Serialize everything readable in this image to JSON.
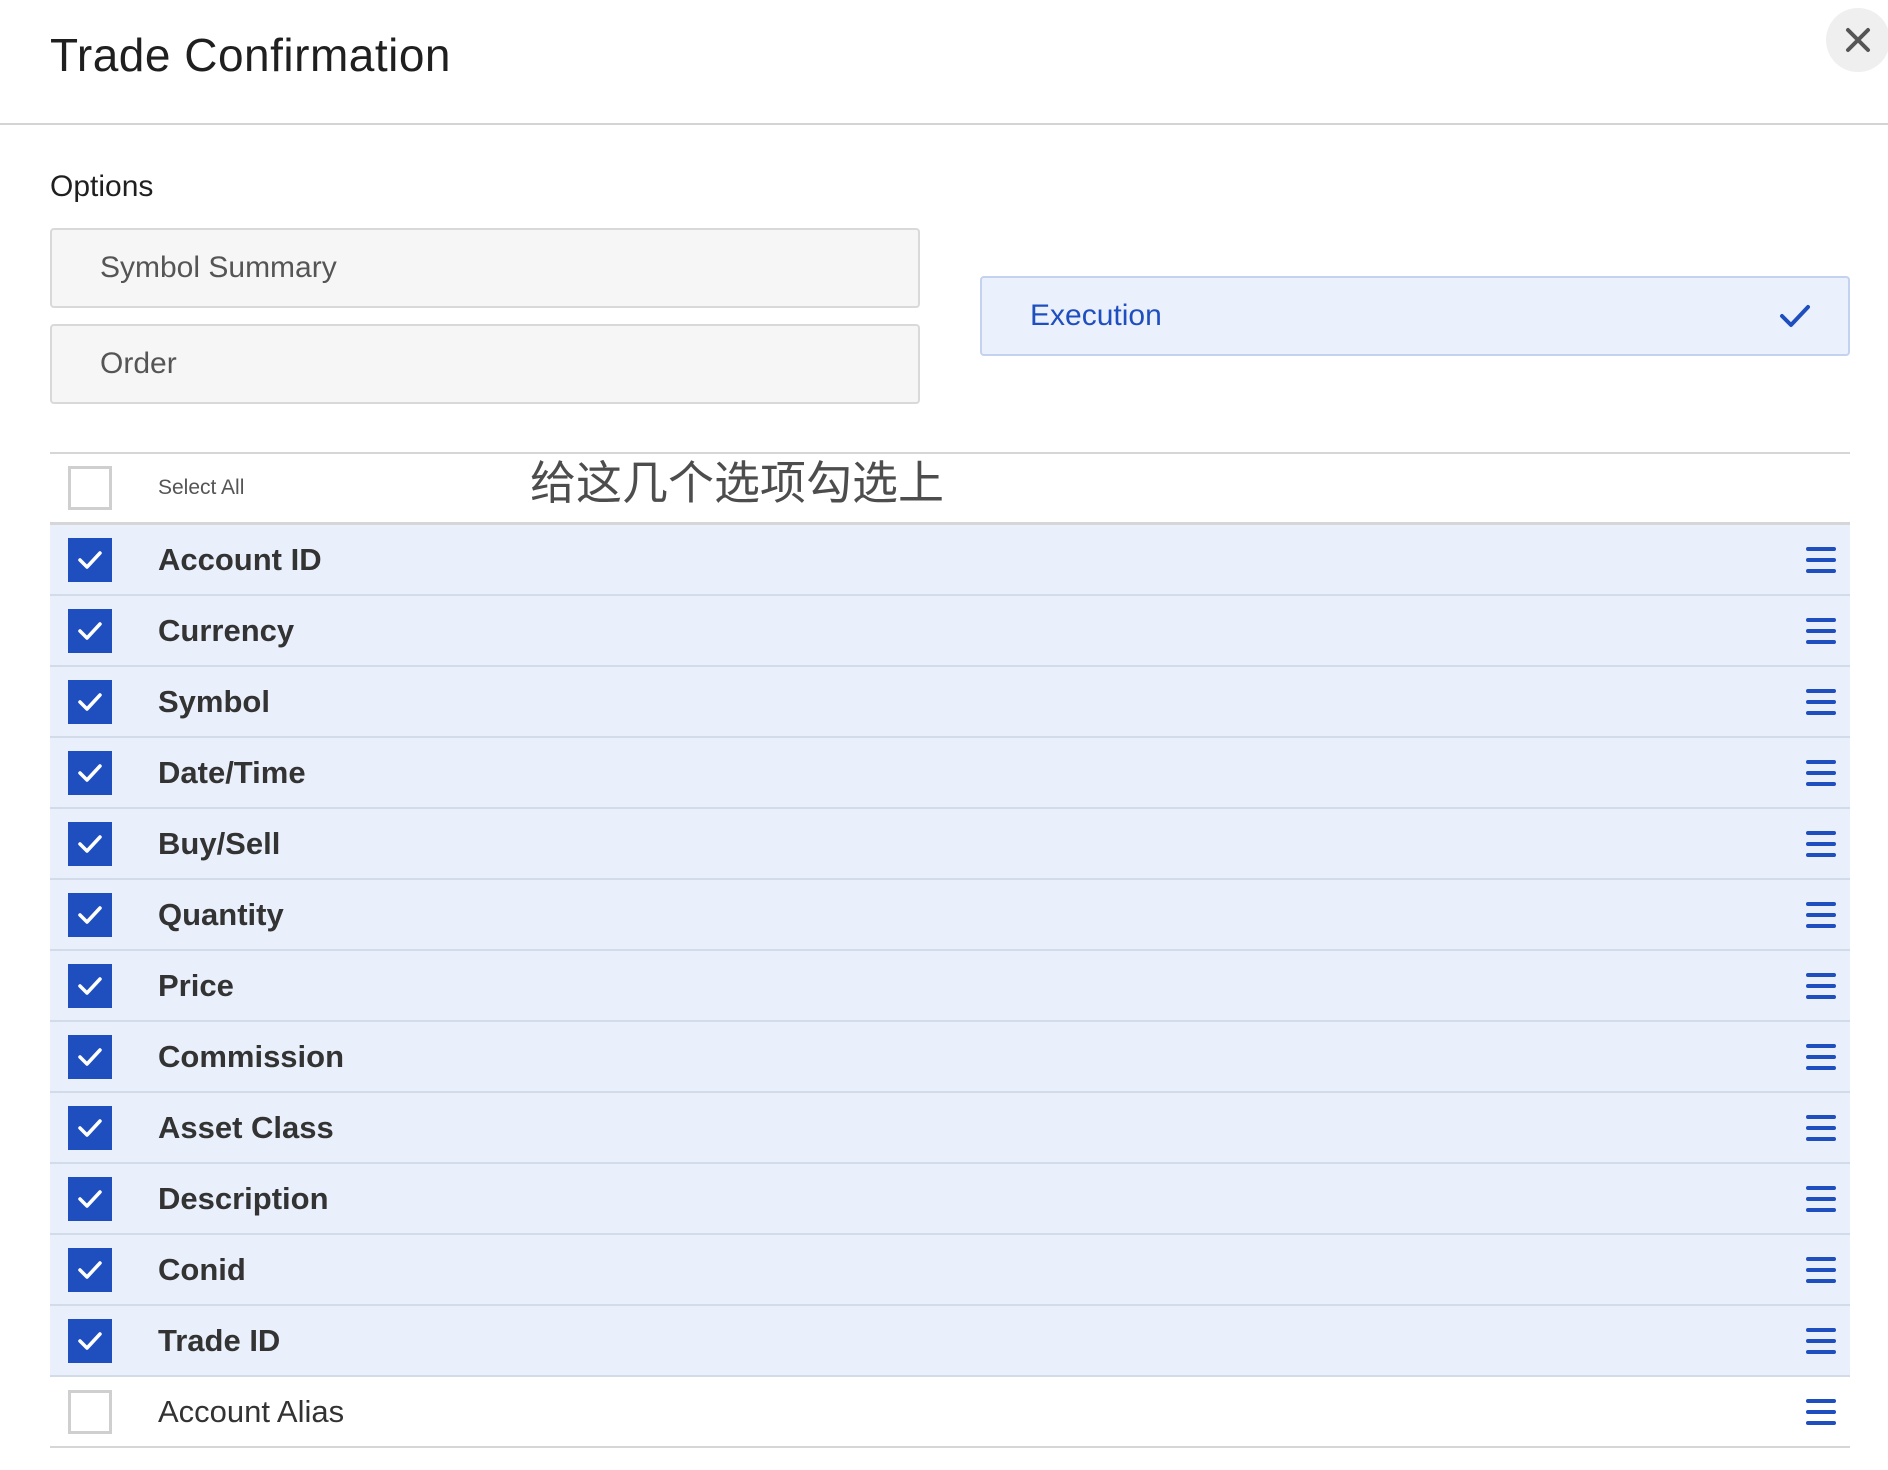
{
  "header": {
    "title": "Trade Confirmation"
  },
  "options": {
    "label": "Options",
    "choices": [
      {
        "label": "Symbol Summary",
        "selected": false
      },
      {
        "label": "Order",
        "selected": false
      },
      {
        "label": "Execution",
        "selected": true
      }
    ]
  },
  "annotation": "给这几个选项勾选上",
  "fields": {
    "select_all_label": "Select All",
    "select_all_checked": false,
    "rows": [
      {
        "label": "Account ID",
        "checked": true
      },
      {
        "label": "Currency",
        "checked": true
      },
      {
        "label": "Symbol",
        "checked": true
      },
      {
        "label": "Date/Time",
        "checked": true
      },
      {
        "label": "Buy/Sell",
        "checked": true
      },
      {
        "label": "Quantity",
        "checked": true
      },
      {
        "label": "Price",
        "checked": true
      },
      {
        "label": "Commission",
        "checked": true
      },
      {
        "label": "Asset Class",
        "checked": true
      },
      {
        "label": "Description",
        "checked": true
      },
      {
        "label": "Conid",
        "checked": true
      },
      {
        "label": "Trade ID",
        "checked": true
      },
      {
        "label": "Account Alias",
        "checked": false
      }
    ]
  },
  "icons": {
    "close": "close-icon",
    "check": "checkmark-icon",
    "drag": "drag-handle-icon"
  },
  "colors": {
    "accent": "#1f4fbf",
    "row_checked_bg": "#eaf0fb",
    "selected_option_bg": "#ebf1fc"
  }
}
